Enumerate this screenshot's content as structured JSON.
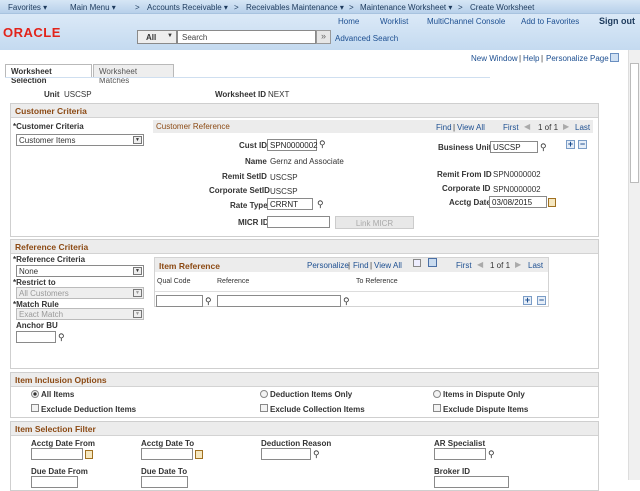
{
  "nav": {
    "items": [
      "Favorites ▾",
      "Main Menu ▾",
      ">",
      "Accounts Receivable ▾",
      ">",
      "Receivables Maintenance ▾",
      ">",
      "Maintenance Worksheet ▾",
      ">",
      "Create Worksheet"
    ]
  },
  "header": {
    "logo": "ORACLE",
    "links": [
      "Home",
      "Worklist",
      "MultiChannel Console",
      "Add to Favorites",
      "Sign out"
    ],
    "search_scope": "All",
    "search_placeholder": "Search",
    "search_go": "»",
    "advanced_search": "Advanced Search"
  },
  "pagebar": {
    "new_window": "New Window",
    "help": "Help",
    "personalize": "Personalize Page"
  },
  "tabs": [
    "Worksheet Selection",
    "Worksheet Matches"
  ],
  "unit": {
    "label": "Unit",
    "value": "USCSP"
  },
  "worksheet_id": {
    "label": "Worksheet ID",
    "value": "NEXT"
  },
  "customer_criteria": {
    "title": "Customer Criteria",
    "criteria_label": "*Customer Criteria",
    "criteria_value": "Customer Items",
    "ref_title": "Customer Reference",
    "find": "Find",
    "view_all": "View All",
    "first": "First",
    "count": "1 of 1",
    "last": "Last",
    "cust_id_label": "Cust ID",
    "cust_id": "SPN0000002",
    "name_label": "Name",
    "name": "Gernz and Associate",
    "remit_setid_label": "Remit SetID",
    "remit_setid": "USCSP",
    "corp_setid_label": "Corporate SetID",
    "corp_setid": "USCSP",
    "rate_type_label": "Rate Type",
    "rate_type": "CRRNT",
    "micr_label": "MICR ID",
    "micr": "",
    "link_micr": "Link MICR",
    "bu_label": "Business Unit",
    "bu": "USCSP",
    "remit_from_label": "Remit From ID",
    "remit_from": "SPN0000002",
    "corp_id_label": "Corporate ID",
    "corp_id": "SPN0000002",
    "acctg_date_label": "Acctg Date",
    "acctg_date": "03/08/2015"
  },
  "reference_criteria": {
    "title": "Reference Criteria",
    "ref_label": "*Reference Criteria",
    "ref_value": "None",
    "restrict_label": "*Restrict to",
    "restrict_value": "All Customers",
    "match_label": "*Match Rule",
    "match_value": "Exact Match",
    "anchor_label": "Anchor BU",
    "grid_title": "Item Reference",
    "personalize": "Personalize",
    "find": "Find",
    "view_all": "View All",
    "first": "First",
    "count": "1 of 1",
    "last": "Last",
    "columns": [
      "Qual Code",
      "Reference",
      "To Reference"
    ]
  },
  "inclusion": {
    "title": "Item Inclusion Options",
    "radios": [
      "All Items",
      "Deduction Items Only",
      "Items in Dispute Only"
    ],
    "selected": "All Items",
    "checks": [
      "Exclude Deduction Items",
      "Exclude Collection Items",
      "Exclude Dispute Items"
    ]
  },
  "filter": {
    "title": "Item Selection Filter",
    "fields": [
      "Acctg Date From",
      "Acctg Date To",
      "Deduction Reason",
      "AR Specialist",
      "Due Date From",
      "Due Date To",
      "Broker ID"
    ]
  },
  "colors": {
    "brand": "#e2231a",
    "section_title": "#8c4a14",
    "link": "#1d4f91"
  }
}
